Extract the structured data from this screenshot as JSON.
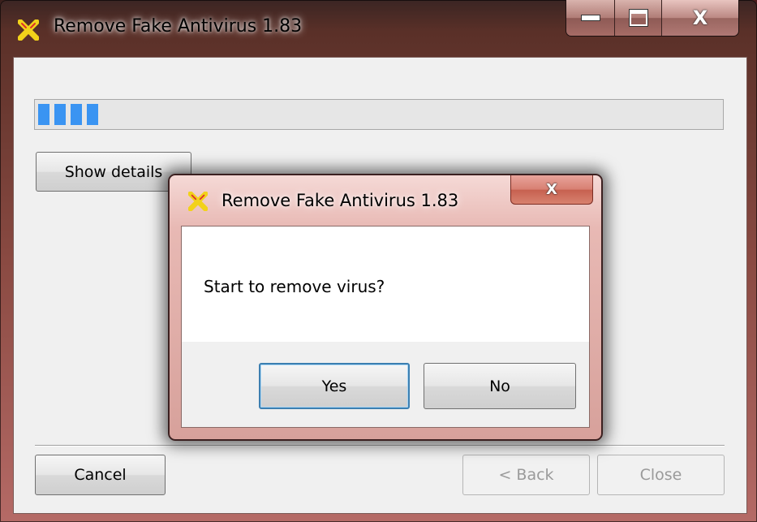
{
  "main_window": {
    "title": "Remove Fake Antivirus 1.83",
    "icon": "yellow-x-app-icon",
    "progress": 0.11,
    "progress_color": "#3a94f2",
    "show_details_label": "Show details",
    "cancel_label": "Cancel",
    "back_label": "< Back",
    "close_label": "Close",
    "caption_close_glyph": "X"
  },
  "dialog": {
    "title": "Remove Fake Antivirus 1.83",
    "message": "Start to remove virus?",
    "yes_label": "Yes",
    "no_label": "No",
    "close_glyph": "X"
  },
  "colors": {
    "app_icon_yellow": "#f2d21a",
    "app_icon_red": "#e0302a"
  }
}
